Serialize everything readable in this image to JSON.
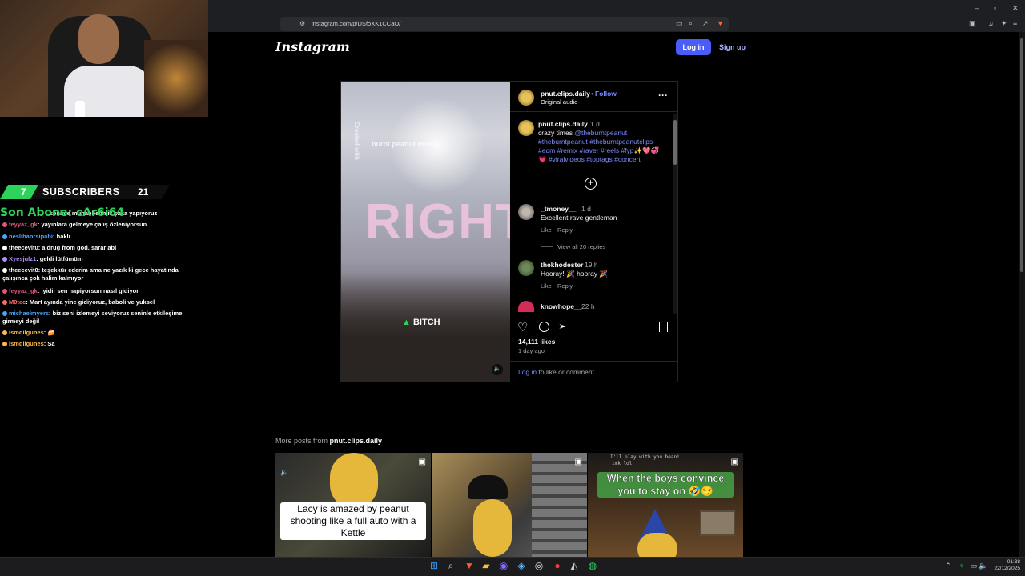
{
  "browser": {
    "url": "instagram.com/p/DSfoXK1CCaO/"
  },
  "instagram": {
    "logo": "Instagram",
    "login_label": "Log in",
    "signup_label": "Sign up"
  },
  "post": {
    "username": "pnut.clips.daily",
    "follow_sep": "•",
    "follow_label": "Follow",
    "audio": "Original audio",
    "video_overlay_top": "burnt peanut music",
    "video_overlay_credit": "Created with",
    "video_overlay_big": "RIGHT",
    "video_overlay_bottom": "BITCH",
    "caption": {
      "username": "pnut.clips.daily",
      "time": "1 d",
      "line1": "crazy times ",
      "mention": "@theburntpeanut",
      "line2": "#theburntpeanut #theburntpeanutclips",
      "line3": "#edm #remix #raver #reels #fyp✨💖💞",
      "line4": "💗 #viralvideos #toptags #concert"
    },
    "comments": [
      {
        "username": "_tmoney__",
        "time": "1 d",
        "text": "Excellent rave gentleman",
        "like": "Like",
        "reply": "Reply",
        "view_replies": "View all 20 replies"
      },
      {
        "username": "thekhodester",
        "time": "19 h",
        "text": "Hooray! 🎉 hooray 🎉",
        "like": "Like",
        "reply": "Reply"
      },
      {
        "username": "knowhope__",
        "time": "22 h"
      }
    ],
    "likes": "14,111 likes",
    "posted": "1 day ago",
    "login_prompt_link": "Log in",
    "login_prompt_rest": " to like or comment."
  },
  "more_posts": {
    "label_prefix": "More posts from ",
    "username": "pnut.clips.daily",
    "thumb1_caption": "Lacy is amazed by peanut shooting like a full auto with a Kettle",
    "thumb3_caption": "When the boys convince you to stay on 🤣😏",
    "thumb3_chat1": "I'll play with you bean!",
    "thumb3_chat2": "imk lol"
  },
  "stream": {
    "subs_left": "7",
    "subs_label": "SUBSCRIBERS",
    "subs_right": "21",
    "last_sub": "Son Abone: cAr6i64",
    "last_sub_behind": "seninle muhabbetimiz şaka yapıyoruz",
    "chat": [
      {
        "user": "feyyaz_gk",
        "color": "#e0557a",
        "text": "yayınlara gelmeye çalış özleniyorsun"
      },
      {
        "user": "neslihanrsipahi",
        "color": "#4aa3ff",
        "text": "haklı"
      },
      {
        "user": "theecevit0",
        "color": "#ffffff",
        "text": "a drug from god. sarar abi"
      },
      {
        "user": "Xyesjulz1",
        "color": "#b38cff",
        "text": "geldi lütfümüm"
      },
      {
        "user": "theecevit0",
        "color": "#ffffff",
        "text": "teşekkür ederim ama ne yazık ki gece hayatında çalışınca çok halim kalmıyor"
      },
      {
        "user": "feyyaz_gk",
        "color": "#e0557a",
        "text": "iyidir sen napiyorsun nasıl gidiyor"
      },
      {
        "user": "M0tec",
        "color": "#ff6b6b",
        "text": "Mart ayında yine gidiyoruz, baboli ve yuksel"
      },
      {
        "user": "michaelmyers",
        "color": "#4aa3ff",
        "text": "biz seni izlemeyi seviyoruz seninle etkileşime girmeyi değil"
      },
      {
        "user": "ismqilgunes",
        "color": "#ffb74a",
        "text": "🍰"
      },
      {
        "user": "ismqilgunes",
        "color": "#ffb74a",
        "text": "Sa"
      }
    ]
  },
  "taskbar": {
    "time": "01:38",
    "date": "22/12/2025"
  },
  "colors": {
    "accent": "#4a5df9",
    "link": "#7d8cff",
    "sub_bar_green": "#2bd35a"
  }
}
